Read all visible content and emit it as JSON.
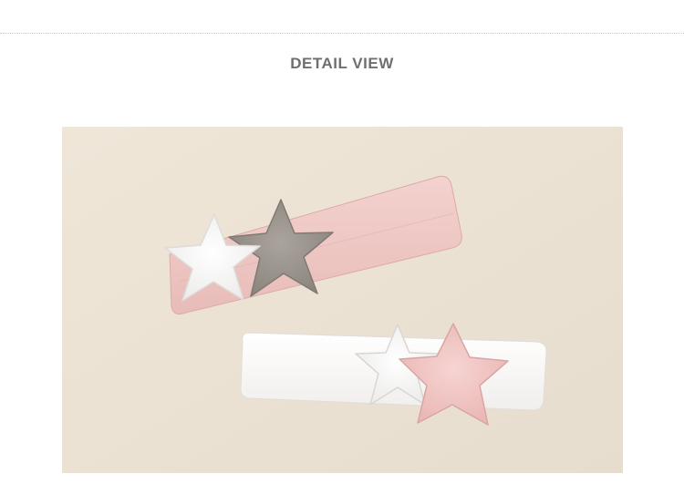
{
  "section": {
    "title": "DETAIL VIEW"
  },
  "photo": {
    "subject": "headbands-with-star-appliques",
    "colors": {
      "background": "#ece3d5",
      "pink_band": "#efc9c6",
      "white_band": "#fbf9f8",
      "grey_star": "#9a948d",
      "pink_star": "#f2c8c7",
      "white_star": "#ffffff"
    }
  }
}
